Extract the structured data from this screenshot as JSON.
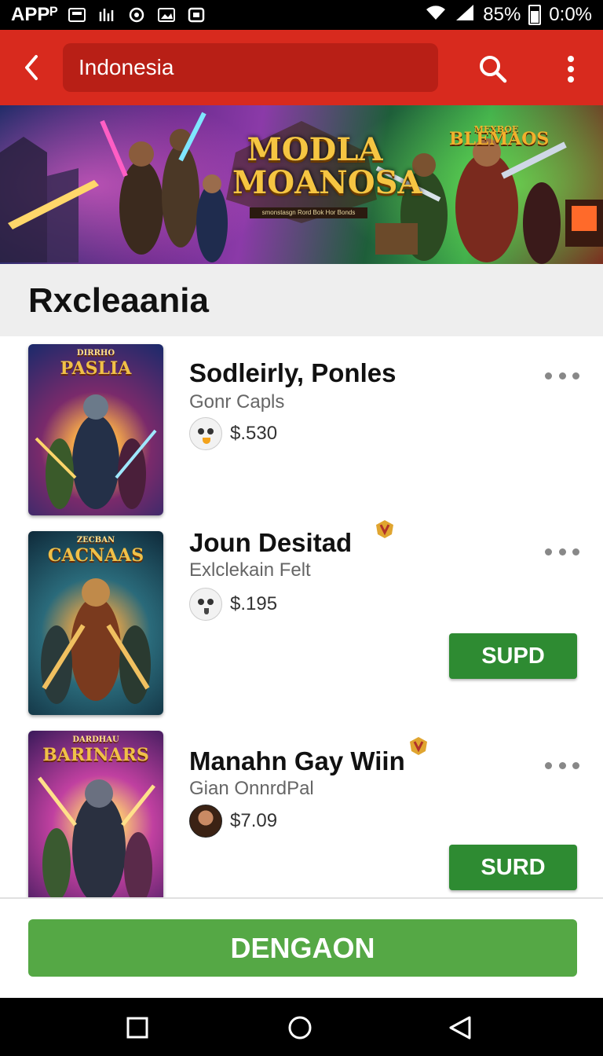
{
  "status_bar": {
    "app_label": "APPᴾ",
    "icons": [
      "notification-icon",
      "signal-icon",
      "cast-icon",
      "image-icon",
      "camera-icon"
    ],
    "battery_percent": "85%",
    "time": "0:0%"
  },
  "app_bar": {
    "search_value": "Indonesia"
  },
  "banner": {
    "title": "MODLA MOANOSA",
    "subtitle": "smonstasgn Rord Bok Hor Bonds",
    "logo_text": "BLEMAOS",
    "logo_small": "MEXBOE"
  },
  "section": {
    "title": "Rxcleaania"
  },
  "items": [
    {
      "title": "Sodleirly, Ponles",
      "subtitle": "Gonr Capls",
      "price": "$.530",
      "cover_title": "PASLIA",
      "cover_top": "DIRRHO",
      "cover_colors": [
        "#1a2a6b",
        "#c24a2b"
      ],
      "has_badge": false,
      "has_button": false,
      "avatar_type": "emoji"
    },
    {
      "title": "Joun Desitad",
      "subtitle": "Exlclekain Felt",
      "price": "$.195",
      "cover_title": "CACNAAS",
      "cover_top": "ZECBAN",
      "cover_colors": [
        "#0f4a5a",
        "#8a5a2a"
      ],
      "has_badge": true,
      "has_button": true,
      "button_label": "SUPD",
      "avatar_type": "emoji"
    },
    {
      "title": "Manahn Gay Wiin",
      "subtitle": "Gian OnnrdPal",
      "price": "$7.09",
      "cover_title": "BARINARS",
      "cover_top": "DARDHAU",
      "cover_colors": [
        "#5a1f7a",
        "#f5a020"
      ],
      "has_badge": true,
      "has_button": true,
      "button_label": "SURD",
      "avatar_type": "photo"
    }
  ],
  "bottom_button": {
    "label": "DENGAON"
  },
  "nav_bar": {
    "buttons": [
      "recents-icon",
      "home-icon",
      "back-icon"
    ]
  },
  "colors": {
    "app_bar": "#d82a1e",
    "search_box": "#b81f16",
    "action_button": "#2e8b32",
    "main_button": "#55a845",
    "section_bg": "#eeeeee"
  }
}
